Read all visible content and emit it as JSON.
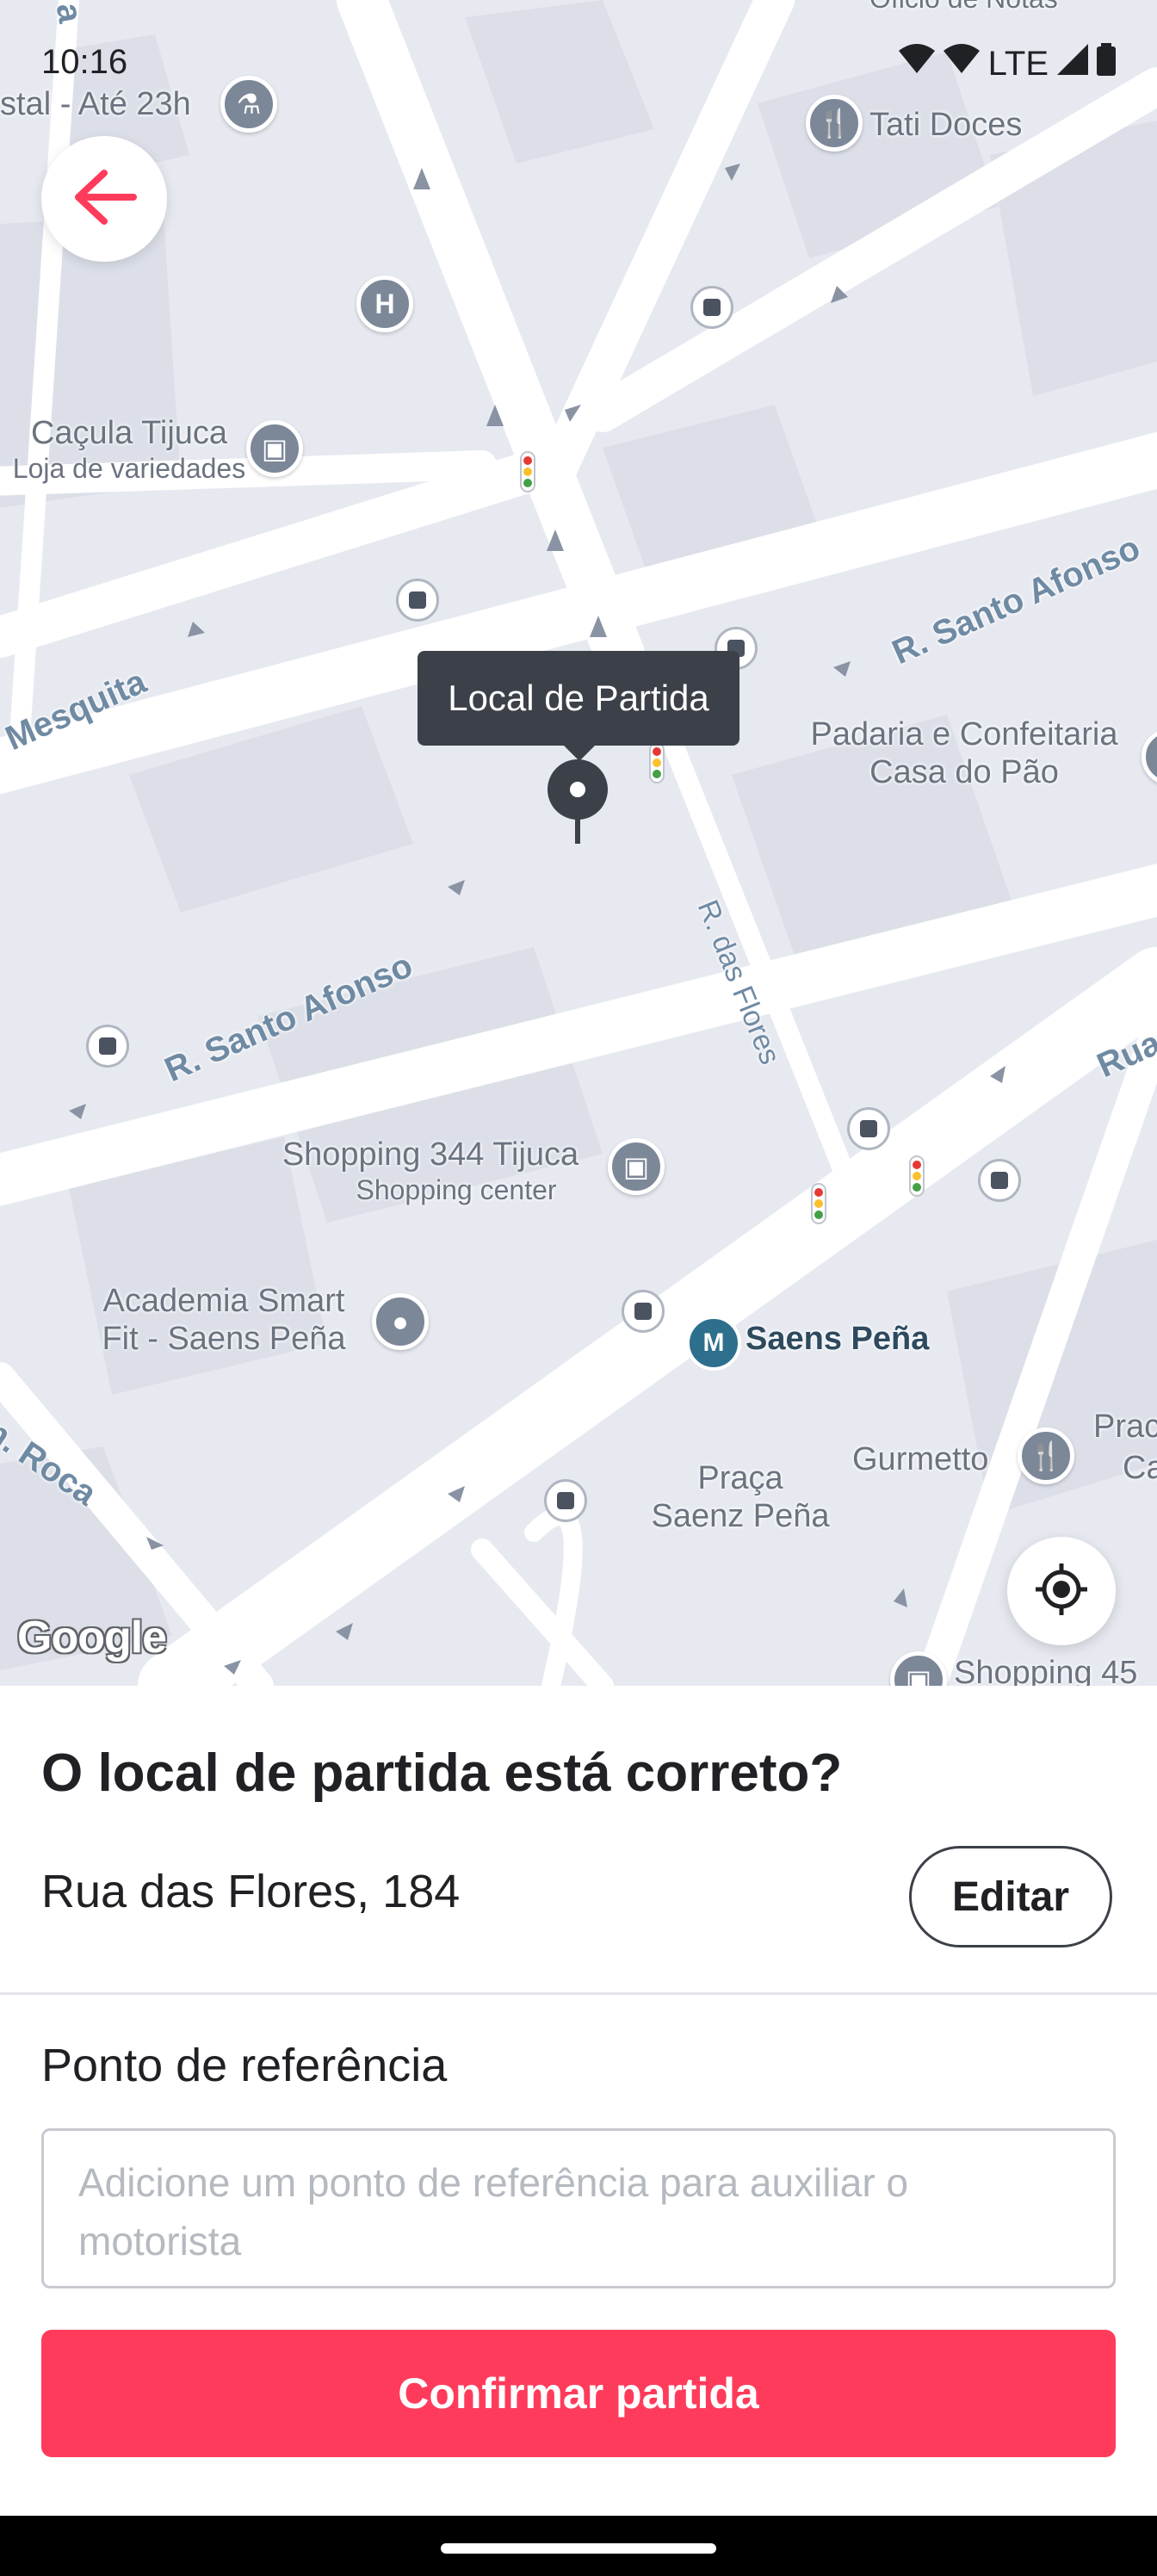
{
  "status_bar": {
    "time": "10:16",
    "network": "LTE",
    "icons": [
      "wifi-icon",
      "wifi-icon",
      "signal-icon",
      "battery-icon"
    ]
  },
  "map": {
    "tooltip": "Local de Partida",
    "streets": {
      "santo_afonso_top": "R. Santo Afonso",
      "santo_afonso_bottom": "R. Santo Afonso",
      "mesquita": "Mesquita",
      "das_flores": "R. das Flores",
      "rua_right": "Rua",
      "roca": "n. Roca",
      "top_left": "a"
    },
    "places": {
      "hostel_partial": "stal - Até 23h",
      "tati_doces": "Tati Doces",
      "cacula_name": "Caçula Tijuca",
      "cacula_sub": "Loja de variedades",
      "padaria_line1": "Padaria e Confeitaria",
      "padaria_line2": "Casa do Pão",
      "shopping344_name": "Shopping 344 Tijuca",
      "shopping344_sub": "Shopping center",
      "academia_line1": "Academia Smart",
      "academia_line2": "Fit - Saens Peña",
      "saens_pena": "Saens Peña",
      "praca_line1": "Praça",
      "praca_line2": "Saenz Peña",
      "gurmetto": "Gurmetto",
      "shopping45": "Shopping 45",
      "prac_partial": "Prac",
      "ca_partial": "Ca",
      "top_partial": "Oficio de Notas"
    },
    "poi_letters": {
      "hospital": "H",
      "metro": "M"
    },
    "attribution": "Google",
    "accent_color": "#ff3b5c"
  },
  "sheet": {
    "question": "O local de partida está correto?",
    "address": "Rua das Flores, 184",
    "edit_label": "Editar",
    "reference_label": "Ponto de referência",
    "reference_placeholder": "Adicione um ponto de referência para auxiliar o motorista",
    "reference_value": "",
    "confirm_label": "Confirmar partida"
  }
}
